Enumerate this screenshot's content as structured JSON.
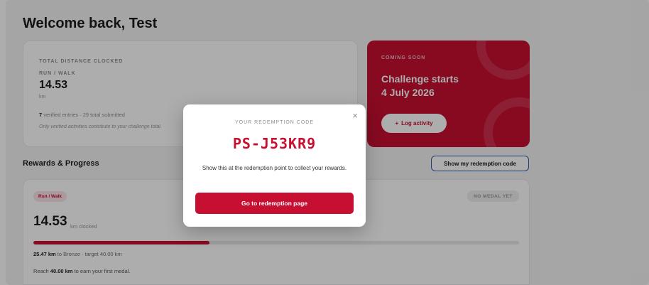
{
  "header": {
    "welcome": "Welcome back, Test"
  },
  "distance_card": {
    "caption": "TOTAL DISTANCE CLOCKED",
    "activity": "RUN / WALK",
    "value": "14.53",
    "unit": "km",
    "verified_count": "7",
    "verified_text": "verified entries",
    "submitted_text": "· 29 total submitted",
    "note": "Only verified activities contribute to your challenge total."
  },
  "promo": {
    "caption": "COMING SOON",
    "title_line1": "Challenge starts",
    "title_line2": "4 July 2026",
    "log_label": "Log activity",
    "log_icon": "plus-icon",
    "color": "#c70f32"
  },
  "rewards": {
    "title": "Rewards & Progress",
    "show_code_label": "Show my redemption code",
    "chip": "Run / Walk",
    "medal_status": "NO MEDAL YET",
    "value": "14.53",
    "unit": "km clocked",
    "progress_fraction": 0.363,
    "remaining": "25.47 km",
    "remaining_suffix": "to Bronze · target 40.00 km",
    "reach_prefix": "Reach",
    "reach_value": "40.00 km",
    "reach_suffix": "to earn your first medal."
  },
  "modal": {
    "caption": "YOUR REDEMPTION CODE",
    "code": "PS-J53KR9",
    "message": "Show this at the redemption point to collect your rewards.",
    "button_label": "Go to redemption page",
    "close_icon": "close-icon"
  }
}
